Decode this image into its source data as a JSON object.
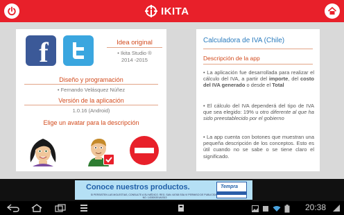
{
  "app": {
    "brand": "IKITA"
  },
  "left": {
    "idea": {
      "heading": "Idea original",
      "lines": [
        "• Ikita Studio ®",
        "2014 -2015"
      ]
    },
    "design": {
      "heading": "Diseño y programación",
      "author": "• Fernando Velásquez Núñez"
    },
    "version": {
      "heading": "Versión de la aplicación",
      "value": "1.0.16 (Android)"
    },
    "avatars": {
      "heading": "Elige un avatar para la descripción"
    }
  },
  "right": {
    "title": "Calculadora de IVA (Chile)",
    "subtitle": "Descripción de la app",
    "p1": {
      "a": "• La aplicación fue desarrollada para realizar el cálculo del IVA, a partir del ",
      "b": "importe",
      "c": ", del ",
      "d": "costo del IVA generado",
      "e": " o desde el ",
      "f": "Total"
    },
    "p2": {
      "a": "• El cálculo del IVA dependerá del tipo de  IVA que sea elegido: 19% u otro ",
      "b": "diferente al que ha sido preestablecido por el gobierno"
    },
    "p3": "• La app cuenta con botones que muestran una pequeña descripción de los conceptos. Esto es útil cuando no se sabe o se tiene claro el significado."
  },
  "ad": {
    "headline": "Conoce nuestros productos.",
    "legal": "SI PERSISTEN LAS MOLESTIAS, CONSULTE A SU MÉDICO. REG. SAN. 64768 SSA VI PERMISO DE PUBLICIDAD NO. 143300201A0313",
    "product": "Tempra"
  },
  "status": {
    "time": "20:38"
  },
  "colors": {
    "brand_red": "#e8202a",
    "accent_orange": "#d24a1c",
    "title_blue": "#2a7bbd"
  }
}
